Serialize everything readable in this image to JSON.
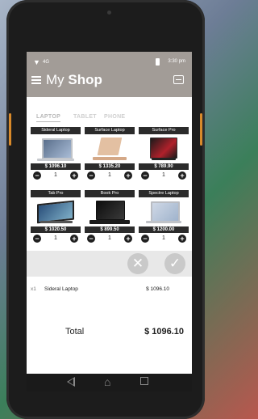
{
  "header": {
    "title_light": "My",
    "title_bold": "Shop",
    "time": "3:30 pm",
    "signal": "4G"
  },
  "tabs": [
    {
      "label": "LAPTOP",
      "active": true
    },
    {
      "label": "TABLET",
      "active": false
    },
    {
      "label": "PHONE",
      "active": false
    }
  ],
  "products": [
    {
      "name": "Sideral Laptop",
      "price": "$ 1096.10",
      "qty": "1"
    },
    {
      "name": "Surface Laptop",
      "price": "$ 1335.20",
      "qty": "1"
    },
    {
      "name": "Surface Pro",
      "price": "$ 789.90",
      "qty": "1"
    },
    {
      "name": "Tab Pro",
      "price": "$ 1020.50",
      "qty": "1"
    },
    {
      "name": "Book Pro",
      "price": "$ 899.50",
      "qty": "1"
    },
    {
      "name": "Spectre Laptop",
      "price": "$ 1200.00",
      "qty": "1"
    }
  ],
  "cart": {
    "items": [
      {
        "qty": "x1",
        "name": "Sideral Laptop",
        "price": "$ 1096.10"
      }
    ],
    "total_label": "Total",
    "total_value": "$ 1096.10"
  },
  "icons": {
    "menu": "hamburger-icon",
    "scan": "barcode-scan-icon",
    "cancel": "x-icon",
    "confirm": "checkmark-icon"
  },
  "colors": {
    "header": "#a29c97",
    "card_label": "#2b2b2b"
  }
}
